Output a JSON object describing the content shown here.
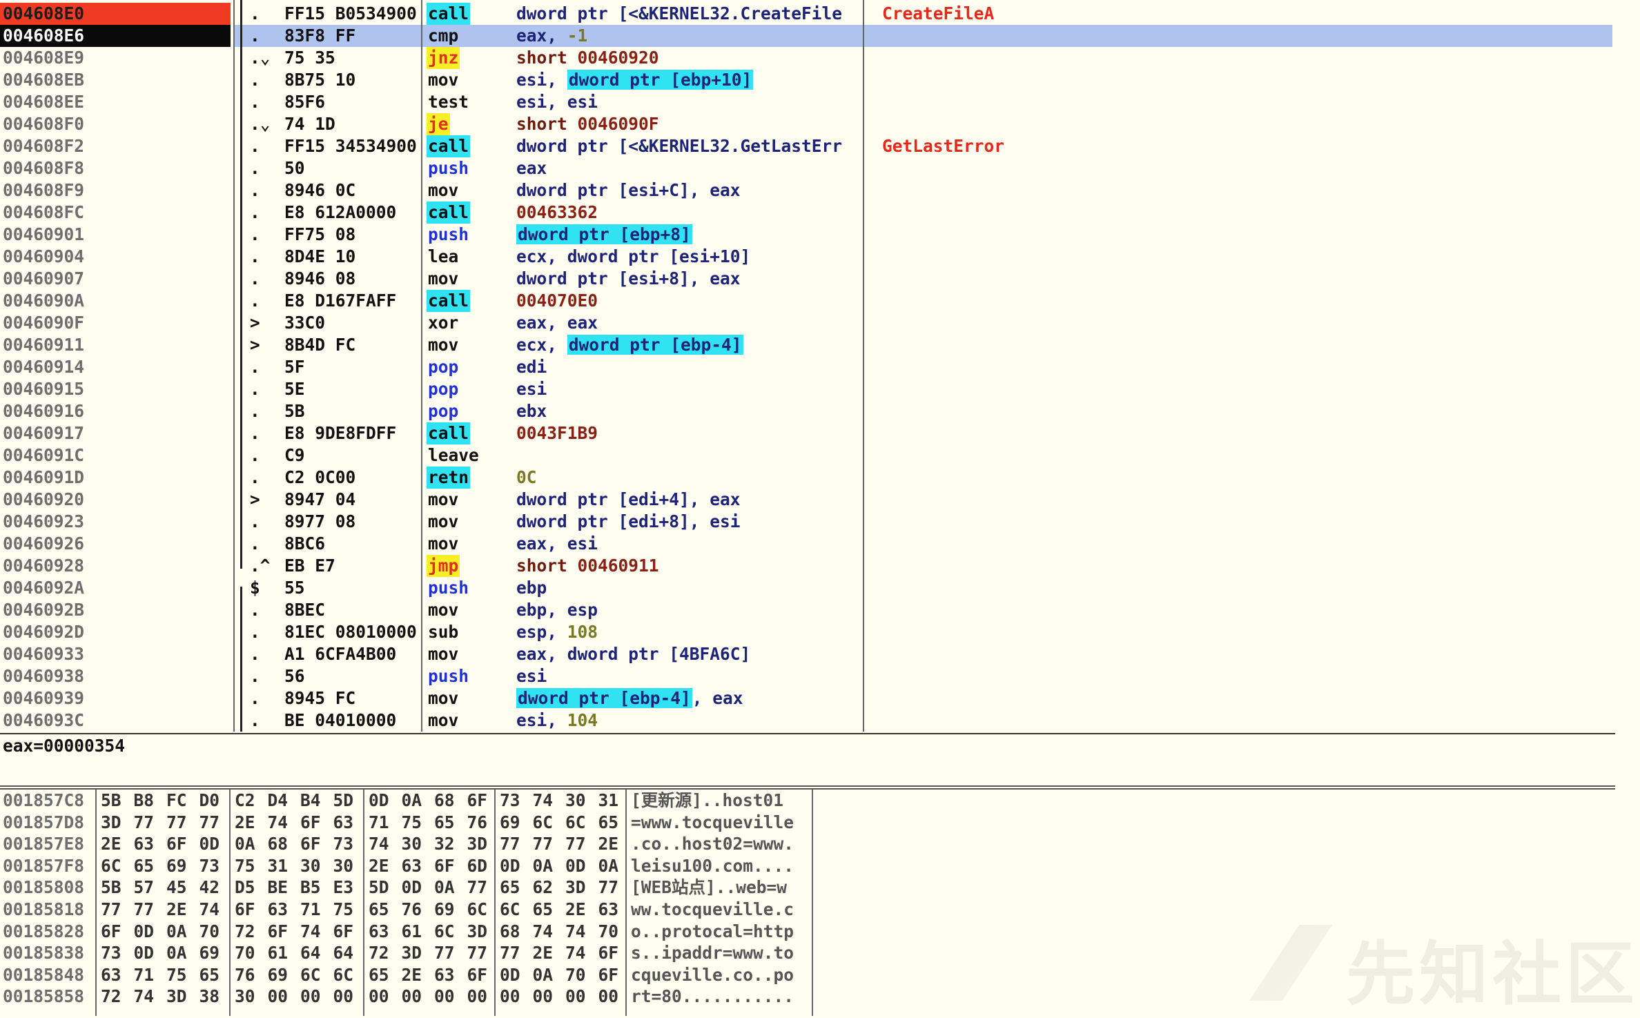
{
  "colors": {
    "eip_highlight": "#ef3b24",
    "current_row": "#0a0a0a",
    "selection_bar": "#aec3ee",
    "call_highlight": "#31e2f3",
    "jcc_highlight": "#f9ef27",
    "api_comment": "#e4291a",
    "background": "#fffef0"
  },
  "disassembly": [
    {
      "addr": "004608E0",
      "mark": ".",
      "hex": "FF15 B0534900",
      "mnem": "call",
      "mtype": "call",
      "ops": [
        {
          "t": "dword ptr [<&KERNEL32.CreateFile",
          "k": "plain"
        }
      ],
      "comment": "CreateFileA",
      "row": "eip"
    },
    {
      "addr": "004608E6",
      "mark": ".",
      "hex": "83F8 FF",
      "mnem": "cmp",
      "mtype": "plain",
      "ops": [
        {
          "t": "eax, ",
          "k": "plain"
        },
        {
          "t": "-1",
          "k": "neg"
        }
      ],
      "comment": "",
      "row": "cur"
    },
    {
      "addr": "004608E9",
      "mark": ".⌄",
      "hex": "75 35",
      "mnem": "jnz",
      "mtype": "jcc",
      "ops": [
        {
          "t": "short ",
          "k": "jmp"
        },
        {
          "t": "00460920",
          "k": "addr"
        }
      ],
      "comment": ""
    },
    {
      "addr": "004608EB",
      "mark": ".",
      "hex": "8B75 10",
      "mnem": "mov",
      "mtype": "plain",
      "ops": [
        {
          "t": "esi, ",
          "k": "plain"
        },
        {
          "t": "dword ptr [ebp+10]",
          "k": "mem"
        }
      ],
      "comment": ""
    },
    {
      "addr": "004608EE",
      "mark": ".",
      "hex": "85F6",
      "mnem": "test",
      "mtype": "plain",
      "ops": [
        {
          "t": "esi, esi",
          "k": "plain"
        }
      ],
      "comment": ""
    },
    {
      "addr": "004608F0",
      "mark": ".⌄",
      "hex": "74 1D",
      "mnem": "je",
      "mtype": "jcc",
      "ops": [
        {
          "t": "short ",
          "k": "jmp"
        },
        {
          "t": "0046090F",
          "k": "addr"
        }
      ],
      "comment": ""
    },
    {
      "addr": "004608F2",
      "mark": ".",
      "hex": "FF15 34534900",
      "mnem": "call",
      "mtype": "call",
      "ops": [
        {
          "t": "dword ptr [<&KERNEL32.GetLastErr",
          "k": "plain"
        }
      ],
      "comment": "GetLastError"
    },
    {
      "addr": "004608F8",
      "mark": ".",
      "hex": "50",
      "mnem": "push",
      "mtype": "push",
      "ops": [
        {
          "t": "eax",
          "k": "plain"
        }
      ],
      "comment": ""
    },
    {
      "addr": "004608F9",
      "mark": ".",
      "hex": "8946 0C",
      "mnem": "mov",
      "mtype": "plain",
      "ops": [
        {
          "t": "dword ptr [esi+C], eax",
          "k": "plain"
        }
      ],
      "comment": ""
    },
    {
      "addr": "004608FC",
      "mark": ".",
      "hex": "E8 612A0000",
      "mnem": "call",
      "mtype": "call",
      "ops": [
        {
          "t": "00463362",
          "k": "addr"
        }
      ],
      "comment": ""
    },
    {
      "addr": "00460901",
      "mark": ".",
      "hex": "FF75 08",
      "mnem": "push",
      "mtype": "push",
      "ops": [
        {
          "t": "dword ptr [ebp+8]",
          "k": "mem"
        }
      ],
      "comment": ""
    },
    {
      "addr": "00460904",
      "mark": ".",
      "hex": "8D4E 10",
      "mnem": "lea",
      "mtype": "plain",
      "ops": [
        {
          "t": "ecx, dword ptr [esi+10]",
          "k": "plain"
        }
      ],
      "comment": ""
    },
    {
      "addr": "00460907",
      "mark": ".",
      "hex": "8946 08",
      "mnem": "mov",
      "mtype": "plain",
      "ops": [
        {
          "t": "dword ptr [esi+8], eax",
          "k": "plain"
        }
      ],
      "comment": ""
    },
    {
      "addr": "0046090A",
      "mark": ".",
      "hex": "E8 D167FAFF",
      "mnem": "call",
      "mtype": "call",
      "ops": [
        {
          "t": "004070E0",
          "k": "addr"
        }
      ],
      "comment": ""
    },
    {
      "addr": "0046090F",
      "mark": ">",
      "hex": "33C0",
      "mnem": "xor",
      "mtype": "plain",
      "ops": [
        {
          "t": "eax, eax",
          "k": "plain"
        }
      ],
      "comment": ""
    },
    {
      "addr": "00460911",
      "mark": ">",
      "hex": "8B4D FC",
      "mnem": "mov",
      "mtype": "plain",
      "ops": [
        {
          "t": "ecx, ",
          "k": "plain"
        },
        {
          "t": "dword ptr [ebp-4]",
          "k": "mem"
        }
      ],
      "comment": ""
    },
    {
      "addr": "00460914",
      "mark": ".",
      "hex": "5F",
      "mnem": "pop",
      "mtype": "push",
      "ops": [
        {
          "t": "edi",
          "k": "plain"
        }
      ],
      "comment": ""
    },
    {
      "addr": "00460915",
      "mark": ".",
      "hex": "5E",
      "mnem": "pop",
      "mtype": "push",
      "ops": [
        {
          "t": "esi",
          "k": "plain"
        }
      ],
      "comment": ""
    },
    {
      "addr": "00460916",
      "mark": ".",
      "hex": "5B",
      "mnem": "pop",
      "mtype": "push",
      "ops": [
        {
          "t": "ebx",
          "k": "plain"
        }
      ],
      "comment": ""
    },
    {
      "addr": "00460917",
      "mark": ".",
      "hex": "E8 9DE8FDFF",
      "mnem": "call",
      "mtype": "call",
      "ops": [
        {
          "t": "0043F1B9",
          "k": "addr"
        }
      ],
      "comment": ""
    },
    {
      "addr": "0046091C",
      "mark": ".",
      "hex": "C9",
      "mnem": "leave",
      "mtype": "plain",
      "ops": [],
      "comment": ""
    },
    {
      "addr": "0046091D",
      "mark": ".",
      "hex": "C2 0C00",
      "mnem": "retn",
      "mtype": "ret",
      "ops": [
        {
          "t": "0C",
          "k": "imm"
        }
      ],
      "comment": ""
    },
    {
      "addr": "00460920",
      "mark": ">",
      "hex": "8947 04",
      "mnem": "mov",
      "mtype": "plain",
      "ops": [
        {
          "t": "dword ptr [edi+4], eax",
          "k": "plain"
        }
      ],
      "comment": ""
    },
    {
      "addr": "00460923",
      "mark": ".",
      "hex": "8977 08",
      "mnem": "mov",
      "mtype": "plain",
      "ops": [
        {
          "t": "dword ptr [edi+8], esi",
          "k": "plain"
        }
      ],
      "comment": ""
    },
    {
      "addr": "00460926",
      "mark": ".",
      "hex": "8BC6",
      "mnem": "mov",
      "mtype": "plain",
      "ops": [
        {
          "t": "eax, esi",
          "k": "plain"
        }
      ],
      "comment": ""
    },
    {
      "addr": "00460928",
      "mark": ".^",
      "hex": "EB E7",
      "mnem": "jmp",
      "mtype": "jcc",
      "ops": [
        {
          "t": "short ",
          "k": "jmp"
        },
        {
          "t": "00460911",
          "k": "addr"
        }
      ],
      "comment": ""
    },
    {
      "addr": "0046092A",
      "mark": "$",
      "hex": "55",
      "mnem": "push",
      "mtype": "push",
      "ops": [
        {
          "t": "ebp",
          "k": "plain"
        }
      ],
      "comment": ""
    },
    {
      "addr": "0046092B",
      "mark": ".",
      "hex": "8BEC",
      "mnem": "mov",
      "mtype": "plain",
      "ops": [
        {
          "t": "ebp, esp",
          "k": "plain"
        }
      ],
      "comment": ""
    },
    {
      "addr": "0046092D",
      "mark": ".",
      "hex": "81EC 08010000",
      "mnem": "sub",
      "mtype": "plain",
      "ops": [
        {
          "t": "esp, ",
          "k": "plain"
        },
        {
          "t": "108",
          "k": "imm"
        }
      ],
      "comment": ""
    },
    {
      "addr": "00460933",
      "mark": ".",
      "hex": "A1 6CFA4B00",
      "mnem": "mov",
      "mtype": "plain",
      "ops": [
        {
          "t": "eax, dword ptr [4BFA6C]",
          "k": "plain"
        }
      ],
      "comment": ""
    },
    {
      "addr": "00460938",
      "mark": ".",
      "hex": "56",
      "mnem": "push",
      "mtype": "push",
      "ops": [
        {
          "t": "esi",
          "k": "plain"
        }
      ],
      "comment": ""
    },
    {
      "addr": "00460939",
      "mark": ".",
      "hex": "8945 FC",
      "mnem": "mov",
      "mtype": "plain",
      "ops": [
        {
          "t": "dword ptr [ebp-4]",
          "k": "mem"
        },
        {
          "t": ", eax",
          "k": "plain"
        }
      ],
      "comment": ""
    },
    {
      "addr": "0046093C",
      "mark": ".",
      "hex": "BE 04010000",
      "mnem": "mov",
      "mtype": "plain",
      "ops": [
        {
          "t": "esi, ",
          "k": "plain"
        },
        {
          "t": "104",
          "k": "imm"
        }
      ],
      "comment": ""
    }
  ],
  "info": "eax=00000354",
  "dump": [
    {
      "addr": "001857C8",
      "hex": [
        "5B",
        "B8",
        "FC",
        "D0",
        "C2",
        "D4",
        "B4",
        "5D",
        "0D",
        "0A",
        "68",
        "6F",
        "73",
        "74",
        "30",
        "31"
      ],
      "ascii": "[更新源]..host01"
    },
    {
      "addr": "001857D8",
      "hex": [
        "3D",
        "77",
        "77",
        "77",
        "2E",
        "74",
        "6F",
        "63",
        "71",
        "75",
        "65",
        "76",
        "69",
        "6C",
        "6C",
        "65"
      ],
      "ascii": "=www.tocqueville"
    },
    {
      "addr": "001857E8",
      "hex": [
        "2E",
        "63",
        "6F",
        "0D",
        "0A",
        "68",
        "6F",
        "73",
        "74",
        "30",
        "32",
        "3D",
        "77",
        "77",
        "77",
        "2E"
      ],
      "ascii": ".co..host02=www."
    },
    {
      "addr": "001857F8",
      "hex": [
        "6C",
        "65",
        "69",
        "73",
        "75",
        "31",
        "30",
        "30",
        "2E",
        "63",
        "6F",
        "6D",
        "0D",
        "0A",
        "0D",
        "0A"
      ],
      "ascii": "leisu100.com...."
    },
    {
      "addr": "00185808",
      "hex": [
        "5B",
        "57",
        "45",
        "42",
        "D5",
        "BE",
        "B5",
        "E3",
        "5D",
        "0D",
        "0A",
        "77",
        "65",
        "62",
        "3D",
        "77"
      ],
      "ascii": "[WEB站点]..web=w"
    },
    {
      "addr": "00185818",
      "hex": [
        "77",
        "77",
        "2E",
        "74",
        "6F",
        "63",
        "71",
        "75",
        "65",
        "76",
        "69",
        "6C",
        "6C",
        "65",
        "2E",
        "63"
      ],
      "ascii": "ww.tocqueville.c"
    },
    {
      "addr": "00185828",
      "hex": [
        "6F",
        "0D",
        "0A",
        "70",
        "72",
        "6F",
        "74",
        "6F",
        "63",
        "61",
        "6C",
        "3D",
        "68",
        "74",
        "74",
        "70"
      ],
      "ascii": "o..protocal=http"
    },
    {
      "addr": "00185838",
      "hex": [
        "73",
        "0D",
        "0A",
        "69",
        "70",
        "61",
        "64",
        "64",
        "72",
        "3D",
        "77",
        "77",
        "77",
        "2E",
        "74",
        "6F"
      ],
      "ascii": "s..ipaddr=www.to"
    },
    {
      "addr": "00185848",
      "hex": [
        "63",
        "71",
        "75",
        "65",
        "76",
        "69",
        "6C",
        "6C",
        "65",
        "2E",
        "63",
        "6F",
        "0D",
        "0A",
        "70",
        "6F"
      ],
      "ascii": "cqueville.co..po"
    },
    {
      "addr": "00185858",
      "hex": [
        "72",
        "74",
        "3D",
        "38",
        "30",
        "00",
        "00",
        "00",
        "00",
        "00",
        "00",
        "00",
        "00",
        "00",
        "00",
        "00"
      ],
      "ascii": "rt=80..........."
    }
  ],
  "watermark": "先知社区"
}
